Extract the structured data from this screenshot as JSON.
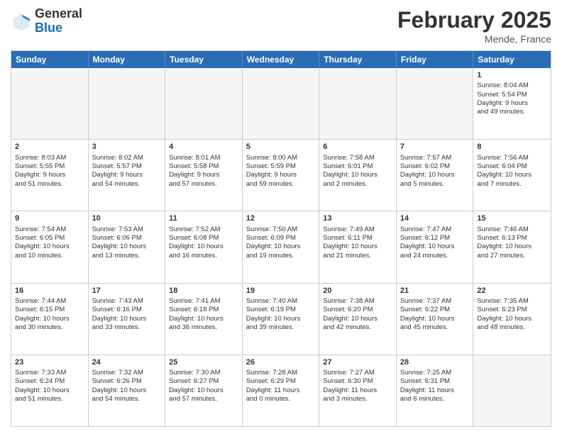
{
  "logo": {
    "general": "General",
    "blue": "Blue"
  },
  "header": {
    "month": "February 2025",
    "location": "Mende, France"
  },
  "days": [
    "Sunday",
    "Monday",
    "Tuesday",
    "Wednesday",
    "Thursday",
    "Friday",
    "Saturday"
  ],
  "weeks": [
    [
      {
        "day": "",
        "info": ""
      },
      {
        "day": "",
        "info": ""
      },
      {
        "day": "",
        "info": ""
      },
      {
        "day": "",
        "info": ""
      },
      {
        "day": "",
        "info": ""
      },
      {
        "day": "",
        "info": ""
      },
      {
        "day": "1",
        "info": "Sunrise: 8:04 AM\nSunset: 5:54 PM\nDaylight: 9 hours\nand 49 minutes."
      }
    ],
    [
      {
        "day": "2",
        "info": "Sunrise: 8:03 AM\nSunset: 5:55 PM\nDaylight: 9 hours\nand 51 minutes."
      },
      {
        "day": "3",
        "info": "Sunrise: 8:02 AM\nSunset: 5:57 PM\nDaylight: 9 hours\nand 54 minutes."
      },
      {
        "day": "4",
        "info": "Sunrise: 8:01 AM\nSunset: 5:58 PM\nDaylight: 9 hours\nand 57 minutes."
      },
      {
        "day": "5",
        "info": "Sunrise: 8:00 AM\nSunset: 5:59 PM\nDaylight: 9 hours\nand 59 minutes."
      },
      {
        "day": "6",
        "info": "Sunrise: 7:58 AM\nSunset: 6:01 PM\nDaylight: 10 hours\nand 2 minutes."
      },
      {
        "day": "7",
        "info": "Sunrise: 7:57 AM\nSunset: 6:02 PM\nDaylight: 10 hours\nand 5 minutes."
      },
      {
        "day": "8",
        "info": "Sunrise: 7:56 AM\nSunset: 6:04 PM\nDaylight: 10 hours\nand 7 minutes."
      }
    ],
    [
      {
        "day": "9",
        "info": "Sunrise: 7:54 AM\nSunset: 6:05 PM\nDaylight: 10 hours\nand 10 minutes."
      },
      {
        "day": "10",
        "info": "Sunrise: 7:53 AM\nSunset: 6:06 PM\nDaylight: 10 hours\nand 13 minutes."
      },
      {
        "day": "11",
        "info": "Sunrise: 7:52 AM\nSunset: 6:08 PM\nDaylight: 10 hours\nand 16 minutes."
      },
      {
        "day": "12",
        "info": "Sunrise: 7:50 AM\nSunset: 6:09 PM\nDaylight: 10 hours\nand 19 minutes."
      },
      {
        "day": "13",
        "info": "Sunrise: 7:49 AM\nSunset: 6:11 PM\nDaylight: 10 hours\nand 21 minutes."
      },
      {
        "day": "14",
        "info": "Sunrise: 7:47 AM\nSunset: 6:12 PM\nDaylight: 10 hours\nand 24 minutes."
      },
      {
        "day": "15",
        "info": "Sunrise: 7:46 AM\nSunset: 6:13 PM\nDaylight: 10 hours\nand 27 minutes."
      }
    ],
    [
      {
        "day": "16",
        "info": "Sunrise: 7:44 AM\nSunset: 6:15 PM\nDaylight: 10 hours\nand 30 minutes."
      },
      {
        "day": "17",
        "info": "Sunrise: 7:43 AM\nSunset: 6:16 PM\nDaylight: 10 hours\nand 33 minutes."
      },
      {
        "day": "18",
        "info": "Sunrise: 7:41 AM\nSunset: 6:18 PM\nDaylight: 10 hours\nand 36 minutes."
      },
      {
        "day": "19",
        "info": "Sunrise: 7:40 AM\nSunset: 6:19 PM\nDaylight: 10 hours\nand 39 minutes."
      },
      {
        "day": "20",
        "info": "Sunrise: 7:38 AM\nSunset: 6:20 PM\nDaylight: 10 hours\nand 42 minutes."
      },
      {
        "day": "21",
        "info": "Sunrise: 7:37 AM\nSunset: 6:22 PM\nDaylight: 10 hours\nand 45 minutes."
      },
      {
        "day": "22",
        "info": "Sunrise: 7:35 AM\nSunset: 6:23 PM\nDaylight: 10 hours\nand 48 minutes."
      }
    ],
    [
      {
        "day": "23",
        "info": "Sunrise: 7:33 AM\nSunset: 6:24 PM\nDaylight: 10 hours\nand 51 minutes."
      },
      {
        "day": "24",
        "info": "Sunrise: 7:32 AM\nSunset: 6:26 PM\nDaylight: 10 hours\nand 54 minutes."
      },
      {
        "day": "25",
        "info": "Sunrise: 7:30 AM\nSunset: 6:27 PM\nDaylight: 10 hours\nand 57 minutes."
      },
      {
        "day": "26",
        "info": "Sunrise: 7:28 AM\nSunset: 6:29 PM\nDaylight: 11 hours\nand 0 minutes."
      },
      {
        "day": "27",
        "info": "Sunrise: 7:27 AM\nSunset: 6:30 PM\nDaylight: 11 hours\nand 3 minutes."
      },
      {
        "day": "28",
        "info": "Sunrise: 7:25 AM\nSunset: 6:31 PM\nDaylight: 11 hours\nand 6 minutes."
      },
      {
        "day": "",
        "info": ""
      }
    ]
  ]
}
